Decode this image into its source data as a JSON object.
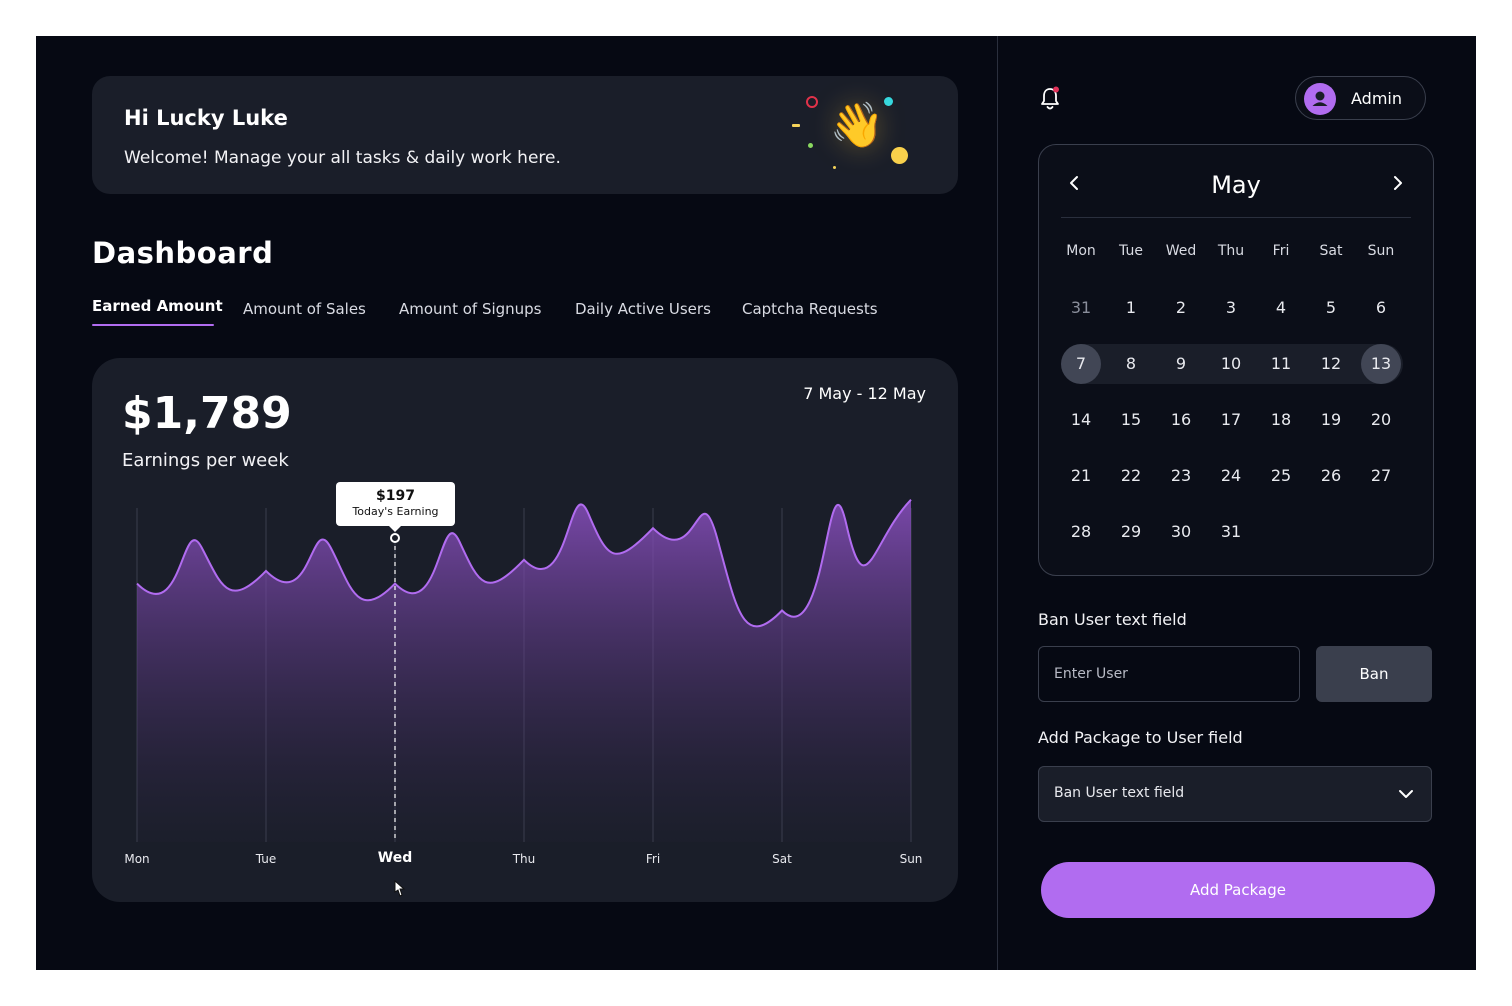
{
  "welcome": {
    "greeting": "Hi Lucky Luke",
    "message": "Welcome! Manage your all tasks & daily work here.",
    "emoji": "👋"
  },
  "dashboard": {
    "title": "Dashboard",
    "tabs": [
      "Earned Amount",
      "Amount of Sales",
      "Amount of Signups",
      "Daily Active Users",
      "Captcha Requests"
    ],
    "active_tab": "Earned Amount"
  },
  "earnings": {
    "amount": "$1,789",
    "label": "Earnings per week",
    "range": "7 May - 12 May",
    "tooltip_value": "$197",
    "tooltip_label": "Today's Earning"
  },
  "chart_data": {
    "type": "area",
    "categories": [
      "Mon",
      "Tue",
      "Wed",
      "Thu",
      "Fri",
      "Sat",
      "Sun"
    ],
    "highlighted_category": "Wed",
    "series": [
      {
        "values": [
          197,
          205,
          197,
          212,
          232,
          180,
          250
        ]
      }
    ],
    "grid": "vertical",
    "color": "#b16cf0"
  },
  "user": {
    "name": "Admin",
    "avatar_icon": "user-icon"
  },
  "calendar": {
    "month": "May",
    "weekdays": [
      "Mon",
      "Tue",
      "Wed",
      "Thu",
      "Fri",
      "Sat",
      "Sun"
    ],
    "weeks": [
      [
        "31",
        "1",
        "2",
        "3",
        "4",
        "5",
        "6"
      ],
      [
        "7",
        "8",
        "9",
        "10",
        "11",
        "12",
        "13"
      ],
      [
        "14",
        "15",
        "16",
        "17",
        "18",
        "19",
        "20"
      ],
      [
        "21",
        "22",
        "23",
        "24",
        "25",
        "26",
        "27"
      ],
      [
        "28",
        "29",
        "30",
        "31",
        "",
        "",
        ""
      ]
    ],
    "selected_range": [
      "7",
      "13"
    ]
  },
  "ban": {
    "label": "Ban User text field",
    "placeholder": "Enter User",
    "button": "Ban"
  },
  "package": {
    "label": "Add Package to User field",
    "selected": "Ban User text field",
    "button": "Add Package"
  },
  "colors": {
    "accent": "#b16cf0",
    "background": "#060913",
    "card": "#1a1e29"
  }
}
